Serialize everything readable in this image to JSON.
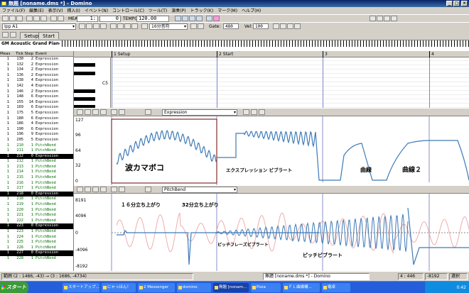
{
  "window": {
    "title": "無題 [noname.dms *] - Domino"
  },
  "menu": [
    "ファイル(F)",
    "編集(E)",
    "表示(V)",
    "挿入(I)",
    "イベント(N)",
    "コントロール(C)",
    "ツール(T)",
    "演奏(P)",
    "トラック(K)",
    "マーク(M)",
    "ヘルプ(H)"
  ],
  "toolbar": {
    "measure_label": "MEAS",
    "measure_value": "1:",
    "tick_value": "0",
    "tempo_label": "TEMPO",
    "tempo_value": "120.00",
    "note_value": "16分音符",
    "gate_label": "Gate:",
    "gate_value": "480",
    "vel_label": "Vel:",
    "vel_value": "100",
    "track_combo": "Ipp A1"
  },
  "tabs": [
    "Setup",
    "Start"
  ],
  "track_name": "GM Acoustic Grand Piano",
  "event_list": {
    "headers": [
      "Meas",
      "Tick",
      "Step",
      "Event"
    ],
    "rows": [
      {
        "m": "1",
        "t": "130",
        "s": "2",
        "e": "Expression",
        "k": "n"
      },
      {
        "m": "1",
        "t": "132",
        "s": "2",
        "e": "Expression",
        "k": "n"
      },
      {
        "m": "1",
        "t": "134",
        "s": "2",
        "e": "Expression",
        "k": "n"
      },
      {
        "m": "1",
        "t": "136",
        "s": "2",
        "e": "Expression",
        "k": "n"
      },
      {
        "m": "1",
        "t": "138",
        "s": "4",
        "e": "Expression",
        "k": "n"
      },
      {
        "m": "1",
        "t": "142",
        "s": "4",
        "e": "Expression",
        "k": "n"
      },
      {
        "m": "1",
        "t": "146",
        "s": "2",
        "e": "Expression",
        "k": "n"
      },
      {
        "m": "1",
        "t": "148",
        "s": "6",
        "e": "Expression",
        "k": "n"
      },
      {
        "m": "1",
        "t": "155",
        "s": "14",
        "e": "Expression",
        "k": "n"
      },
      {
        "m": "1",
        "t": "169",
        "s": "6",
        "e": "Expression",
        "k": "n"
      },
      {
        "m": "1",
        "t": "175",
        "s": "5",
        "e": "Expression",
        "k": "n"
      },
      {
        "m": "1",
        "t": "180",
        "s": "6",
        "e": "Expression",
        "k": "n"
      },
      {
        "m": "1",
        "t": "186",
        "s": "4",
        "e": "Expression",
        "k": "n"
      },
      {
        "m": "1",
        "t": "190",
        "s": "6",
        "e": "Expression",
        "k": "n"
      },
      {
        "m": "1",
        "t": "196",
        "s": "9",
        "e": "Expression",
        "k": "n"
      },
      {
        "m": "1",
        "t": "205",
        "s": "5",
        "e": "Expression",
        "k": "n"
      },
      {
        "m": "1",
        "t": "210",
        "s": "1",
        "e": "PitchBend",
        "k": "g"
      },
      {
        "m": "1",
        "t": "211",
        "s": "1",
        "e": "PitchBend",
        "k": "g"
      },
      {
        "m": "1",
        "t": "212",
        "s": "0",
        "e": "Expression",
        "k": "b"
      },
      {
        "m": "1",
        "t": "212",
        "s": "1",
        "e": "PitchBend",
        "k": "g"
      },
      {
        "m": "1",
        "t": "213",
        "s": "1",
        "e": "PitchBend",
        "k": "g"
      },
      {
        "m": "1",
        "t": "214",
        "s": "1",
        "e": "PitchBend",
        "k": "g"
      },
      {
        "m": "1",
        "t": "215",
        "s": "1",
        "e": "PitchBend",
        "k": "g"
      },
      {
        "m": "1",
        "t": "216",
        "s": "1",
        "e": "PitchBend",
        "k": "g"
      },
      {
        "m": "1",
        "t": "217",
        "s": "1",
        "e": "PitchBend",
        "k": "g"
      },
      {
        "m": "1",
        "t": "218",
        "s": "0",
        "e": "Expression",
        "k": "b"
      },
      {
        "m": "1",
        "t": "218",
        "s": "1",
        "e": "PitchBend",
        "k": "g"
      },
      {
        "m": "1",
        "t": "219",
        "s": "1",
        "e": "PitchBend",
        "k": "g"
      },
      {
        "m": "1",
        "t": "220",
        "s": "1",
        "e": "PitchBend",
        "k": "g"
      },
      {
        "m": "1",
        "t": "221",
        "s": "1",
        "e": "PitchBend",
        "k": "g"
      },
      {
        "m": "1",
        "t": "222",
        "s": "1",
        "e": "PitchBend",
        "k": "g"
      },
      {
        "m": "1",
        "t": "223",
        "s": "0",
        "e": "Expression",
        "k": "b"
      },
      {
        "m": "1",
        "t": "223",
        "s": "1",
        "e": "PitchBend",
        "k": "g"
      },
      {
        "m": "1",
        "t": "224",
        "s": "1",
        "e": "PitchBend",
        "k": "g"
      },
      {
        "m": "1",
        "t": "225",
        "s": "1",
        "e": "PitchBend",
        "k": "g"
      },
      {
        "m": "1",
        "t": "226",
        "s": "1",
        "e": "PitchBend",
        "k": "g"
      },
      {
        "m": "1",
        "t": "227",
        "s": "0",
        "e": "Expression",
        "k": "b"
      },
      {
        "m": "1",
        "t": "228",
        "s": "1",
        "e": "PitchBend",
        "k": "g"
      }
    ]
  },
  "ruler": {
    "marks": [
      "1 Setup",
      "2 Start",
      "3",
      "4"
    ]
  },
  "piano_roll": {
    "note_label": "C5"
  },
  "expression_panel": {
    "selector": "Expression",
    "y_labels": [
      "127",
      "96",
      "64",
      "32",
      "0"
    ],
    "annotations": [
      "波カマボコ",
      "エクスプレッション ビブラート",
      "曲線",
      "曲線２"
    ]
  },
  "pitchbend_panel": {
    "selector": "PitchBend",
    "y_labels": [
      "8191",
      "4096",
      "0",
      "-4096",
      "-8192"
    ],
    "annotations": [
      "１６分立ち上がり",
      "32分立ち上がり",
      "ピッチフレーズビブラート",
      "ピッチビブラート"
    ]
  },
  "status": {
    "position": "範囲 (2 : 1486, -43) → (3 : 1686, -4734)",
    "mini_title": "無題 [noname.dms *] - Domino",
    "right_value": "4 : 446",
    "right_value2": "-8192",
    "mode": "選択"
  },
  "taskbar": {
    "start": "スタート",
    "tasks": [
      "スタートアップ...",
      "にゃっほん！",
      "2 Messenger",
      "domino",
      "無題 [nonam...",
      "Pixia",
      "ＦＬ曲線構...",
      "電卓"
    ],
    "clock": "0:42"
  },
  "colors": {
    "curve": "#3d7ab8",
    "pitch_ghost": "#e88a8a",
    "selection": "#000000",
    "accent": "#0a246a"
  }
}
